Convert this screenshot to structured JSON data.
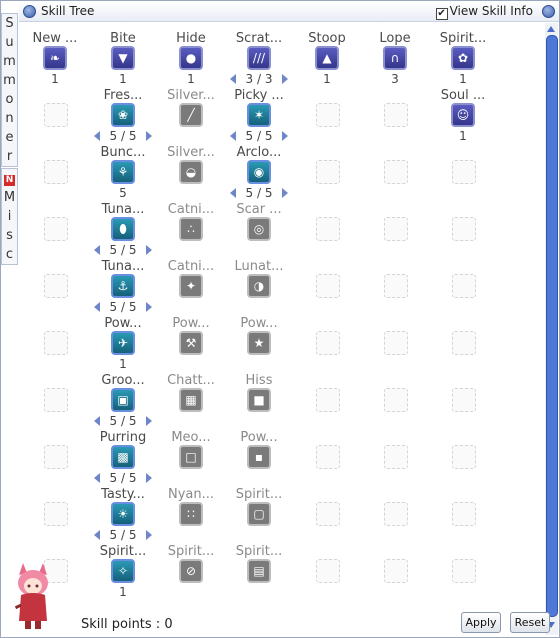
{
  "window": {
    "title": "Skill Tree",
    "view_info_label": "View Skill Info",
    "view_info_checked": "✔"
  },
  "tabs": [
    {
      "id": "summoner",
      "letters": [
        "S",
        "u",
        "m",
        "m",
        "o",
        "n",
        "e",
        "r"
      ]
    },
    {
      "id": "misc",
      "badge": "N",
      "letters": [
        "M",
        "i",
        "s",
        "c"
      ]
    }
  ],
  "skills": [
    {
      "row": 0,
      "col": 0,
      "name": "New ...",
      "level": "1",
      "style": "purple",
      "glyph": "❧"
    },
    {
      "row": 0,
      "col": 1,
      "name": "Bite",
      "level": "1",
      "style": "purple",
      "glyph": "▼"
    },
    {
      "row": 0,
      "col": 2,
      "name": "Hide",
      "level": "1",
      "style": "purple",
      "glyph": "●"
    },
    {
      "row": 0,
      "col": 3,
      "name": "Scrat...",
      "level": "3 / 3",
      "arrows": true,
      "style": "purple",
      "glyph": "///"
    },
    {
      "row": 0,
      "col": 4,
      "name": "Stoop",
      "level": "1",
      "style": "purple",
      "glyph": "▲"
    },
    {
      "row": 0,
      "col": 5,
      "name": "Lope",
      "level": "3",
      "style": "purple",
      "glyph": "∩"
    },
    {
      "row": 0,
      "col": 6,
      "name": "Spirit...",
      "level": "1",
      "style": "purple",
      "glyph": "✿"
    },
    {
      "row": 1,
      "col": 1,
      "name": "Fres...",
      "level": "5 / 5",
      "arrows": true,
      "style": "teal",
      "glyph": "❀"
    },
    {
      "row": 1,
      "col": 2,
      "name": "Silver...",
      "style": "grey",
      "glyph": "╱"
    },
    {
      "row": 1,
      "col": 3,
      "name": "Picky ...",
      "level": "5 / 5",
      "arrows": true,
      "style": "teal",
      "glyph": "✶"
    },
    {
      "row": 1,
      "col": 6,
      "name": "Soul ...",
      "level": "1",
      "style": "purple",
      "glyph": "☺"
    },
    {
      "row": 2,
      "col": 1,
      "name": "Bunc...",
      "level": "5",
      "style": "teal",
      "glyph": "⚘"
    },
    {
      "row": 2,
      "col": 2,
      "name": "Silver...",
      "style": "grey",
      "glyph": "◒"
    },
    {
      "row": 2,
      "col": 3,
      "name": "Arclo...",
      "level": "5 / 5",
      "arrows": true,
      "style": "teal",
      "glyph": "◉"
    },
    {
      "row": 3,
      "col": 1,
      "name": "Tuna...",
      "level": "5 / 5",
      "arrows": true,
      "style": "teal",
      "glyph": "⬮"
    },
    {
      "row": 3,
      "col": 2,
      "name": "Catni...",
      "style": "grey",
      "glyph": "∴"
    },
    {
      "row": 3,
      "col": 3,
      "name": "Scar ...",
      "style": "grey",
      "glyph": "◎"
    },
    {
      "row": 4,
      "col": 1,
      "name": "Tuna...",
      "level": "5 / 5",
      "arrows": true,
      "style": "teal",
      "glyph": "⚓"
    },
    {
      "row": 4,
      "col": 2,
      "name": "Catni...",
      "style": "grey",
      "glyph": "✦"
    },
    {
      "row": 4,
      "col": 3,
      "name": "Lunat...",
      "style": "grey",
      "glyph": "◑"
    },
    {
      "row": 5,
      "col": 1,
      "name": "Pow...",
      "level": "1",
      "style": "teal",
      "glyph": "✈"
    },
    {
      "row": 5,
      "col": 2,
      "name": "Pow...",
      "style": "grey",
      "glyph": "⚒"
    },
    {
      "row": 5,
      "col": 3,
      "name": "Pow...",
      "style": "grey",
      "glyph": "★"
    },
    {
      "row": 6,
      "col": 1,
      "name": "Groo...",
      "level": "5 / 5",
      "arrows": true,
      "style": "teal",
      "glyph": "▣"
    },
    {
      "row": 6,
      "col": 2,
      "name": "Chatt...",
      "style": "grey",
      "glyph": "▦"
    },
    {
      "row": 6,
      "col": 3,
      "name": "Hiss",
      "style": "grey",
      "glyph": "■"
    },
    {
      "row": 7,
      "col": 1,
      "name": "Purring",
      "level": "5 / 5",
      "arrows": true,
      "style": "teal",
      "glyph": "▩"
    },
    {
      "row": 7,
      "col": 2,
      "name": "Meo...",
      "style": "grey",
      "glyph": "□"
    },
    {
      "row": 7,
      "col": 3,
      "name": "Pow...",
      "style": "grey",
      "glyph": "▪"
    },
    {
      "row": 8,
      "col": 1,
      "name": "Tasty...",
      "level": "5 / 5",
      "arrows": true,
      "style": "teal",
      "glyph": "☀"
    },
    {
      "row": 8,
      "col": 2,
      "name": "Nyan...",
      "style": "grey",
      "glyph": "∷"
    },
    {
      "row": 8,
      "col": 3,
      "name": "Spirit...",
      "style": "grey",
      "glyph": "▢"
    },
    {
      "row": 9,
      "col": 1,
      "name": "Spirit...",
      "level": "1",
      "style": "teal",
      "glyph": "✧"
    },
    {
      "row": 9,
      "col": 2,
      "name": "Spirit...",
      "style": "grey",
      "glyph": "⊘"
    },
    {
      "row": 9,
      "col": 3,
      "name": "Spirit...",
      "style": "grey",
      "glyph": "▤"
    }
  ],
  "footer": {
    "skill_points_label": "Skill points : 0",
    "apply_label": "Apply",
    "reset_label": "Reset"
  }
}
